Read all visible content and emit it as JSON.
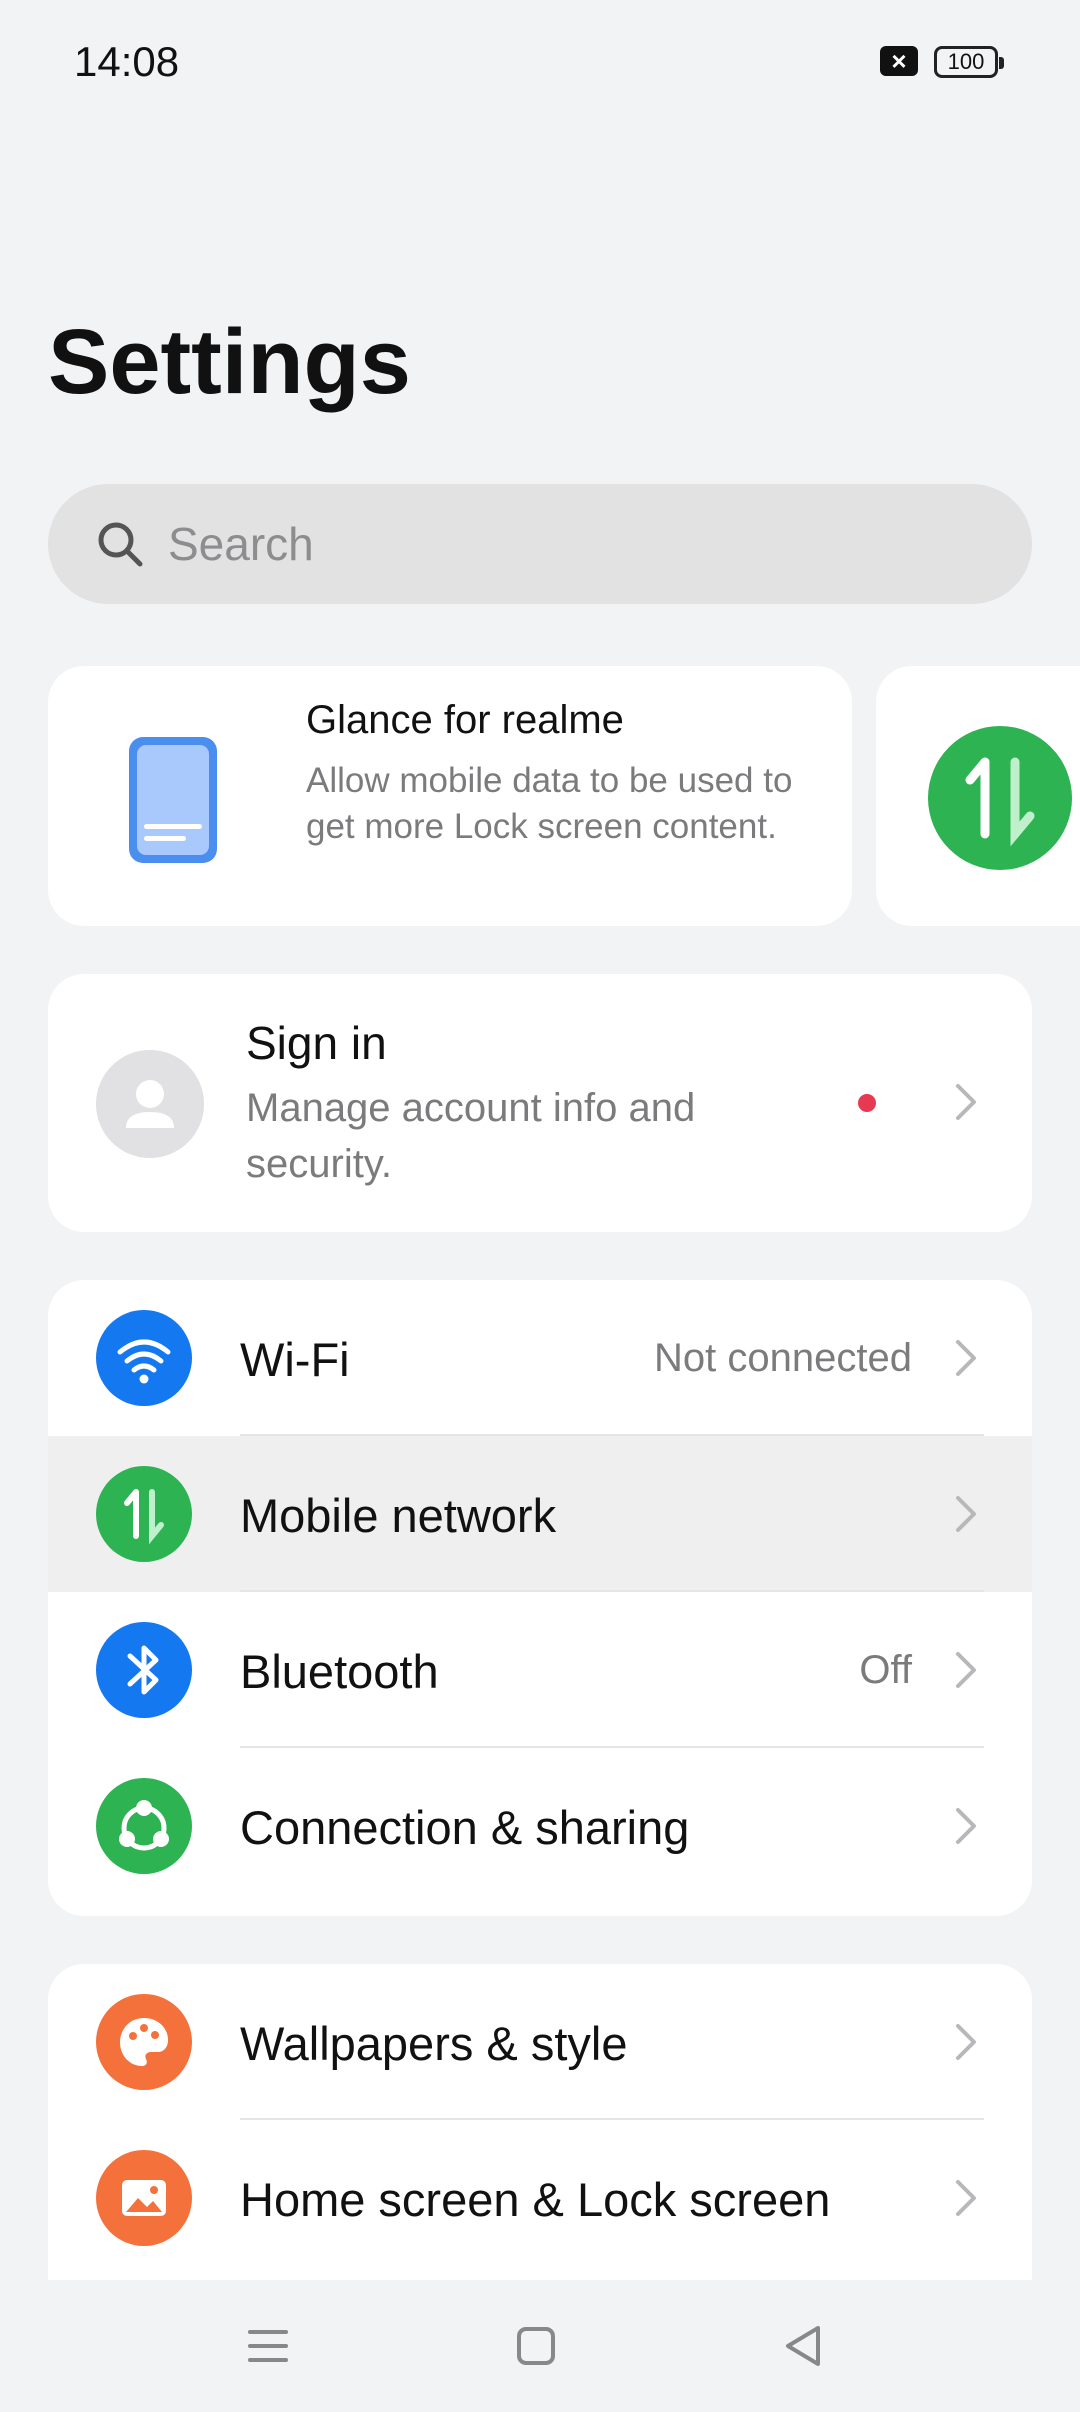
{
  "status_bar": {
    "time": "14:08",
    "battery": "100"
  },
  "page": {
    "title": "Settings"
  },
  "search": {
    "placeholder": "Search"
  },
  "cards": {
    "glance": {
      "title": "Glance for realme",
      "description": "Allow mobile data to be used to get more Lock screen content."
    },
    "sign_in": {
      "title": "Sign in",
      "description": "Manage account info and security."
    }
  },
  "groups": {
    "connectivity": [
      {
        "label": "Wi-Fi",
        "value": "Not connected",
        "icon": "wifi-icon",
        "color": "#1478f0"
      },
      {
        "label": "Mobile network",
        "value": "",
        "icon": "mobile-data-icon",
        "color": "#2db352"
      },
      {
        "label": "Bluetooth",
        "value": "Off",
        "icon": "bluetooth-icon",
        "color": "#1478f0"
      },
      {
        "label": "Connection & sharing",
        "value": "",
        "icon": "share-icon",
        "color": "#2db352"
      }
    ],
    "personalization": [
      {
        "label": "Wallpapers & style",
        "value": "",
        "icon": "palette-icon",
        "color": "#f5713c"
      },
      {
        "label": "Home screen & Lock screen",
        "value": "",
        "icon": "image-icon",
        "color": "#f5713c"
      }
    ]
  },
  "colors": {
    "background": "#f2f3f5",
    "card": "#ffffff",
    "accent_blue": "#1478f0",
    "accent_green": "#2db352",
    "accent_orange": "#f5713c",
    "notification_dot": "#e73a52"
  },
  "nav": {
    "items": [
      "menu-icon",
      "home-icon",
      "back-icon"
    ]
  }
}
